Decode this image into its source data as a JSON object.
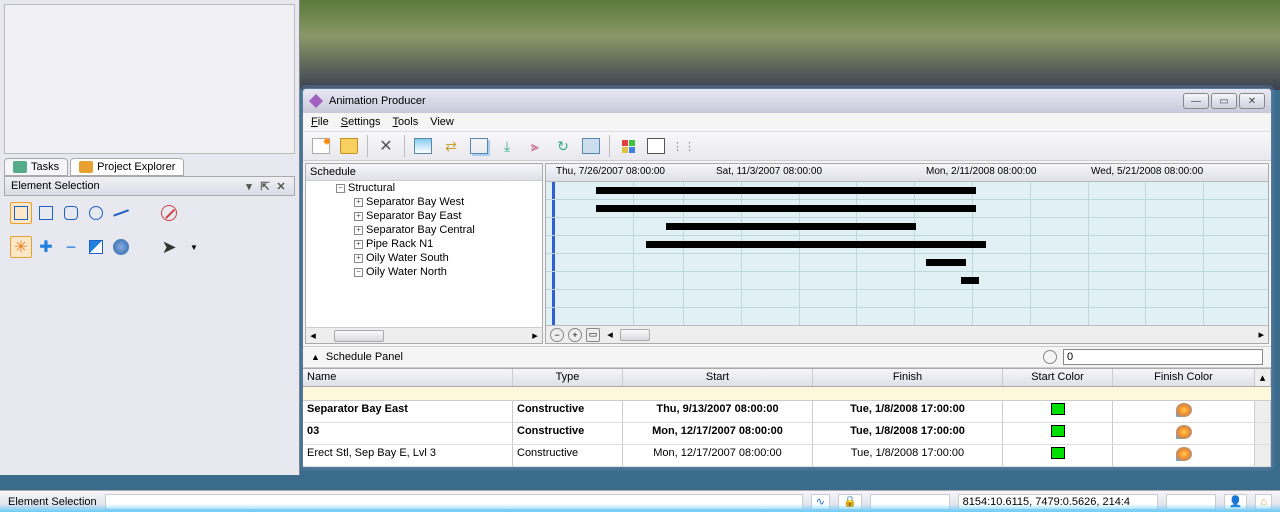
{
  "sidebar": {
    "tabs": [
      {
        "icon": "tasks-icon",
        "label": "Tasks"
      },
      {
        "icon": "project-explorer-icon",
        "label": "Project Explorer"
      }
    ],
    "panel_title": "Element Selection"
  },
  "animation_producer": {
    "title": "Animation Producer",
    "menu": {
      "file": "File",
      "settings": "Settings",
      "tools": "Tools",
      "view": "View"
    },
    "schedule_tree": {
      "header": "Schedule",
      "root": "Structural",
      "nodes": [
        "Separator Bay West",
        "Separator Bay East",
        "Separator Bay Central",
        "Pipe Rack N1",
        "Oily Water South",
        "Oily Water North"
      ]
    },
    "timeline": {
      "dates": [
        "Thu, 7/26/2007 08:00:00",
        "Sat, 11/3/2007 08:00:00",
        "Mon, 2/11/2008 08:00:00",
        "Wed, 5/21/2008 08:00:00"
      ]
    },
    "schedule_panel": {
      "title": "Schedule Panel",
      "time_value": "0",
      "columns": {
        "name": "Name",
        "type": "Type",
        "start": "Start",
        "finish": "Finish",
        "start_color": "Start Color",
        "finish_color": "Finish Color"
      },
      "rows": [
        {
          "name": "Separator Bay East",
          "type": "Constructive",
          "start": "Thu, 9/13/2007 08:00:00",
          "finish": "Tue, 1/8/2008 17:00:00",
          "start_color": "#00e000",
          "bold": true
        },
        {
          "name": "03",
          "type": "Constructive",
          "start": "Mon, 12/17/2007 08:00:00",
          "finish": "Tue, 1/8/2008 17:00:00",
          "start_color": "#00e000",
          "bold": true
        },
        {
          "name": "Erect Stl, Sep Bay E, Lvl 3",
          "type": "Constructive",
          "start": "Mon, 12/17/2007 08:00:00",
          "finish": "Tue, 1/8/2008 17:00:00",
          "start_color": "#00e000",
          "bold": false
        }
      ]
    }
  },
  "status": {
    "mode": "Element Selection",
    "coords": "8154:10.6115, 7479:0.5626, 214:4"
  }
}
